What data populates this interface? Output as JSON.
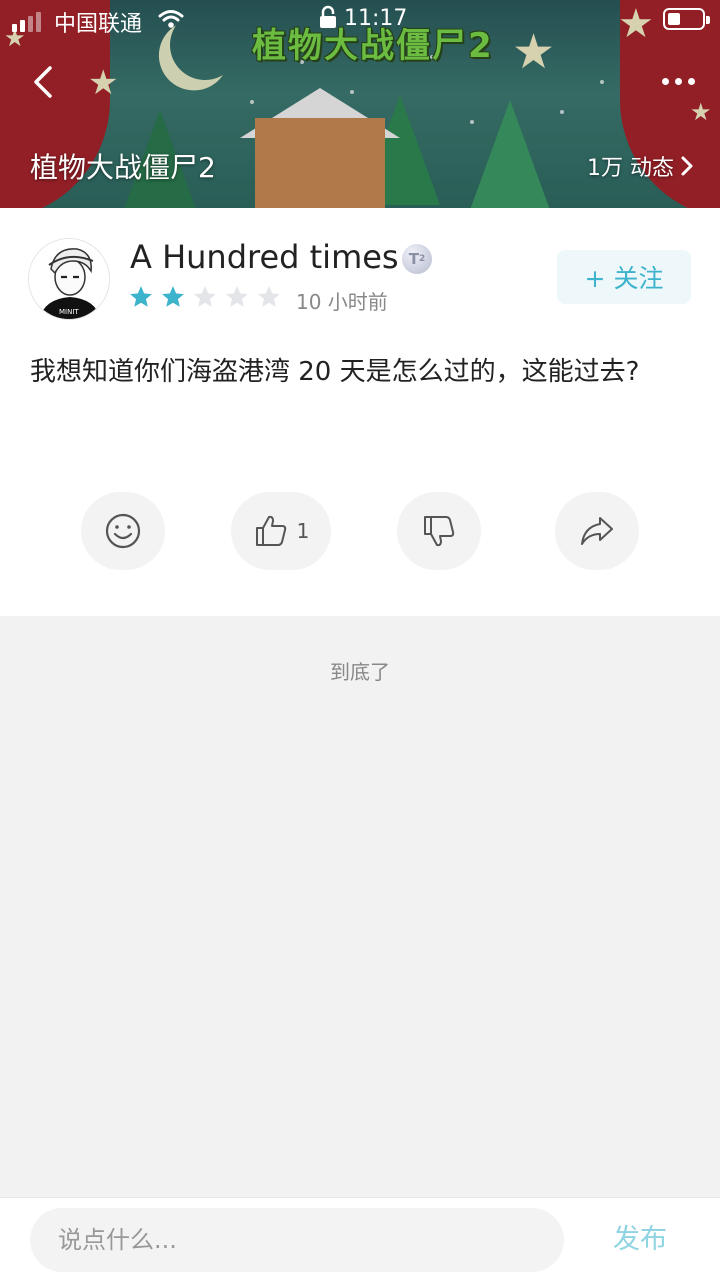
{
  "status_bar": {
    "carrier": "中国联通",
    "time": "11:17"
  },
  "header": {
    "game_title": "植物大战僵尸2",
    "logo_text": "植物大战僵尸2",
    "feed_count_label": "1万 动态"
  },
  "post": {
    "author": "A Hundred times",
    "level_badge": "T2",
    "rating": 2,
    "rating_max": 5,
    "time_ago": "10 小时前",
    "follow_label": "+ 关注",
    "content": "我想知道你们海盗港湾 20 天是怎么过的，这能过去?",
    "like_count": "1"
  },
  "feed_end_text": "到底了",
  "comment_bar": {
    "placeholder": "说点什么...",
    "publish_label": "发布"
  },
  "colors": {
    "accent": "#3db3cc",
    "star_active": "#3db3cc",
    "star_inactive": "#e3e5e8",
    "publish_disabled": "#8fd4e3"
  }
}
